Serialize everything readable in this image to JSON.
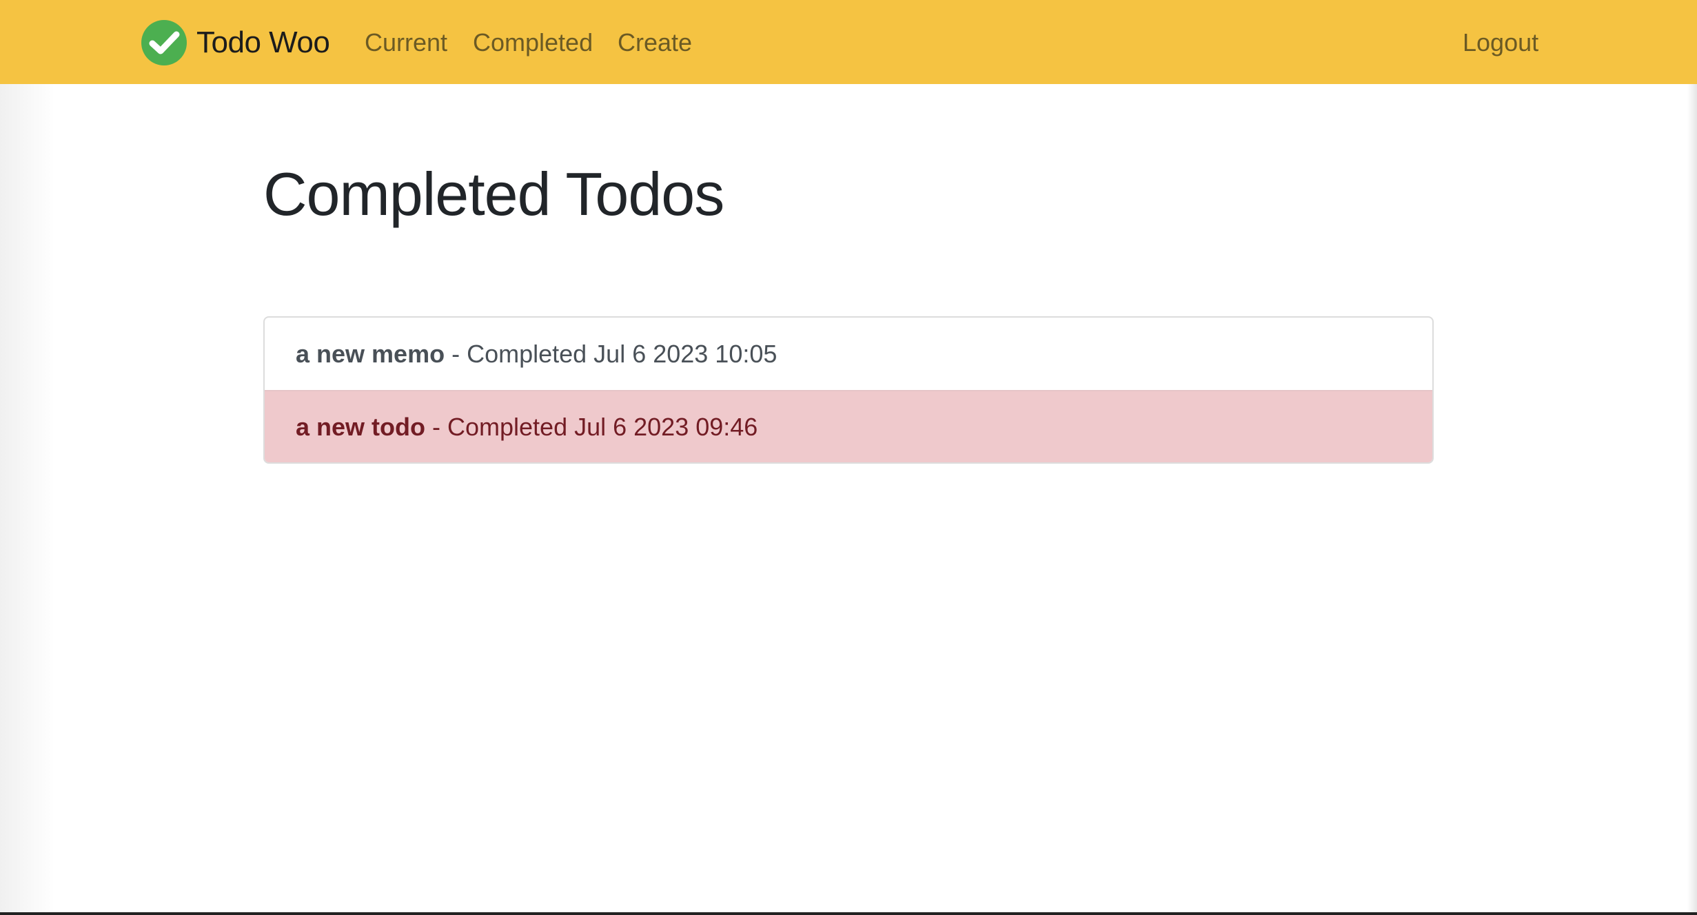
{
  "navbar": {
    "brand": "Todo Woo",
    "brand_icon": "check-circle-icon",
    "links": {
      "current": "Current",
      "completed": "Completed",
      "create": "Create",
      "logout": "Logout"
    }
  },
  "main": {
    "title": "Completed Todos",
    "todos": [
      {
        "title": "a new memo",
        "completed_text": " - Completed Jul 6 2023 10:05",
        "style": "default"
      },
      {
        "title": "a new todo",
        "completed_text": " - Completed Jul 6 2023 09:46",
        "style": "danger"
      }
    ]
  },
  "colors": {
    "navbar_bg": "#f5c342",
    "logo_green": "#4caf50",
    "danger_bg": "#efc9cc",
    "danger_text": "#721c24"
  }
}
